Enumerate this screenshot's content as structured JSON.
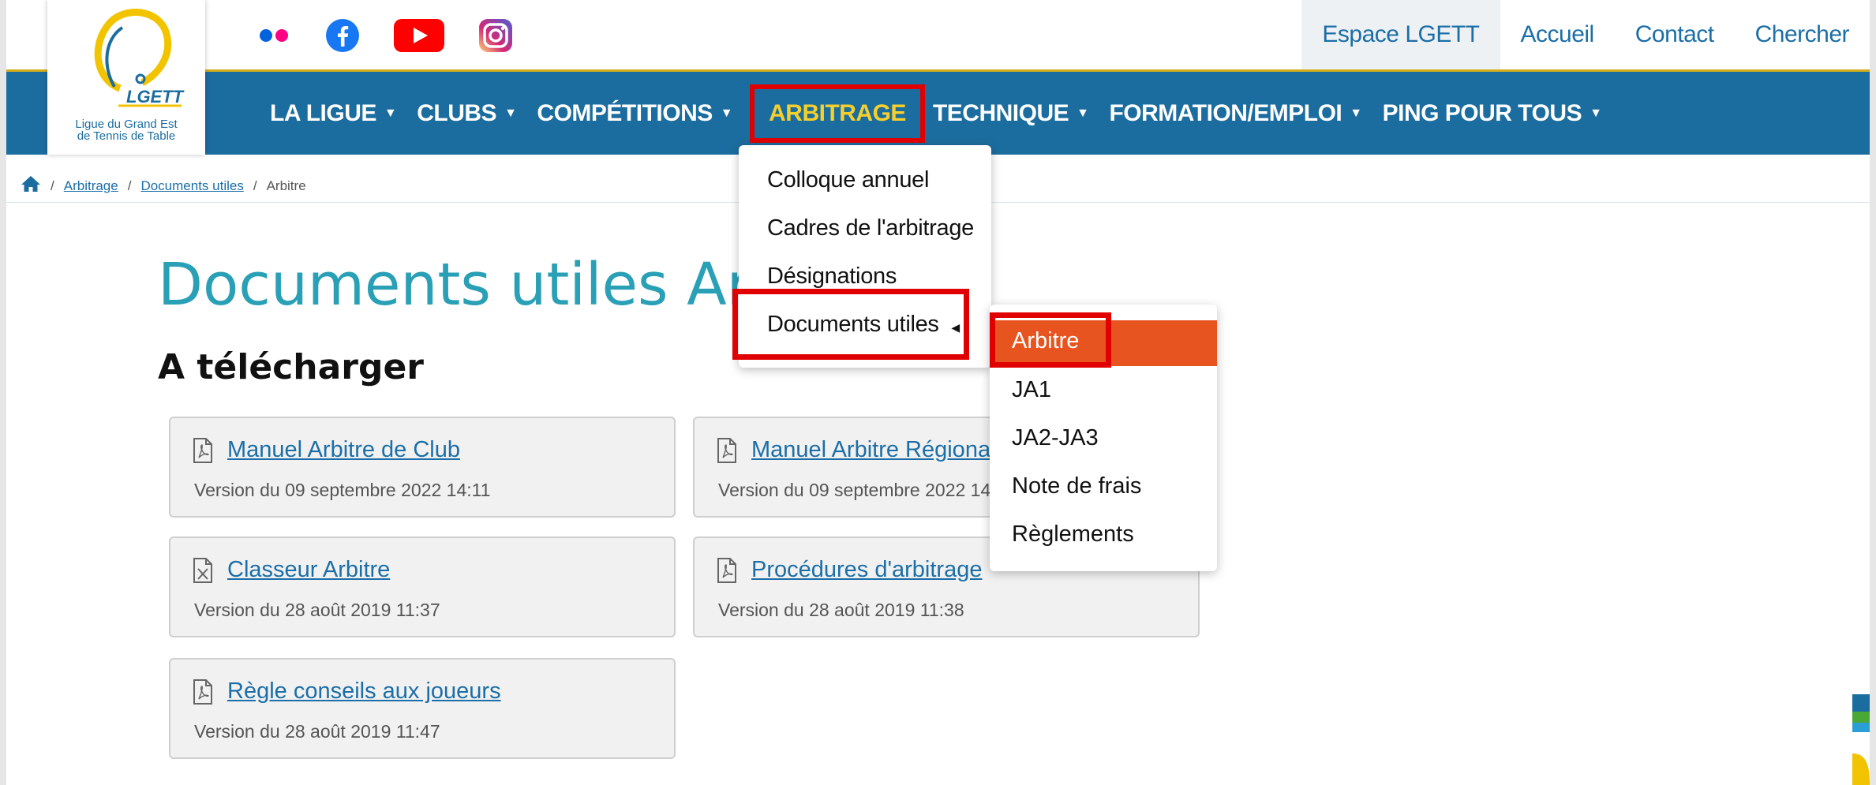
{
  "social": {
    "icons": [
      "flickr-icon",
      "facebook-icon",
      "youtube-icon",
      "instagram-icon"
    ],
    "colors": {
      "flickr_blue": "#0063dc",
      "flickr_pink": "#ff0084",
      "facebook": "#1877f2",
      "youtube": "#ff0000",
      "instagram": "#c13584"
    }
  },
  "utility_nav": {
    "espace": "Espace LGETT",
    "accueil": "Accueil",
    "contact": "Contact",
    "chercher": "Chercher"
  },
  "logo": {
    "brand": "LGETT",
    "line1": "Ligue du Grand Est",
    "line2": "de Tennis de Table"
  },
  "nav": {
    "items": [
      "LA LIGUE",
      "CLUBS",
      "COMPÉTITIONS",
      "ARBITRAGE",
      "TECHNIQUE",
      "FORMATION/EMPLOI",
      "PING POUR TOUS"
    ],
    "active_index": 3,
    "colors": {
      "bar": "#1c6d9f",
      "accent": "#d4ad1b",
      "active_text": "#f5d02c"
    }
  },
  "breadcrumb": {
    "home_icon": "home-icon",
    "items": [
      "Arbitrage",
      "Documents utiles",
      "Arbitre"
    ],
    "separator": "/"
  },
  "page": {
    "title": "Documents utiles Arbitre",
    "section": "A télécharger"
  },
  "documents": [
    {
      "title": "Manuel Arbitre de Club",
      "version": "Version du 09 septembre 2022 14:11",
      "icon": "pdf-icon"
    },
    {
      "title": "Manuel Arbitre Régional",
      "version": "Version du 09 septembre 2022 14:11",
      "icon": "pdf-icon"
    },
    {
      "title": "Classeur Arbitre",
      "version": "Version du 28 août 2019 11:37",
      "icon": "excel-icon"
    },
    {
      "title": "Procédures d'arbitrage",
      "version": "Version du 28 août 2019 11:38",
      "icon": "pdf-icon"
    },
    {
      "title": "Règle conseils aux joueurs",
      "version": "Version du 28 août 2019 11:47",
      "icon": "pdf-icon"
    }
  ],
  "dropdown": {
    "items": [
      "Colloque annuel",
      "Cadres de l'arbitrage",
      "Désignations",
      "Documents utiles"
    ],
    "open_index": 3
  },
  "submenu": {
    "items": [
      "Arbitre",
      "JA1",
      "JA2-JA3",
      "Note de frais",
      "Règlements"
    ],
    "active_index": 0,
    "active_color": "#e8541f"
  },
  "highlight_color": "#e00000"
}
